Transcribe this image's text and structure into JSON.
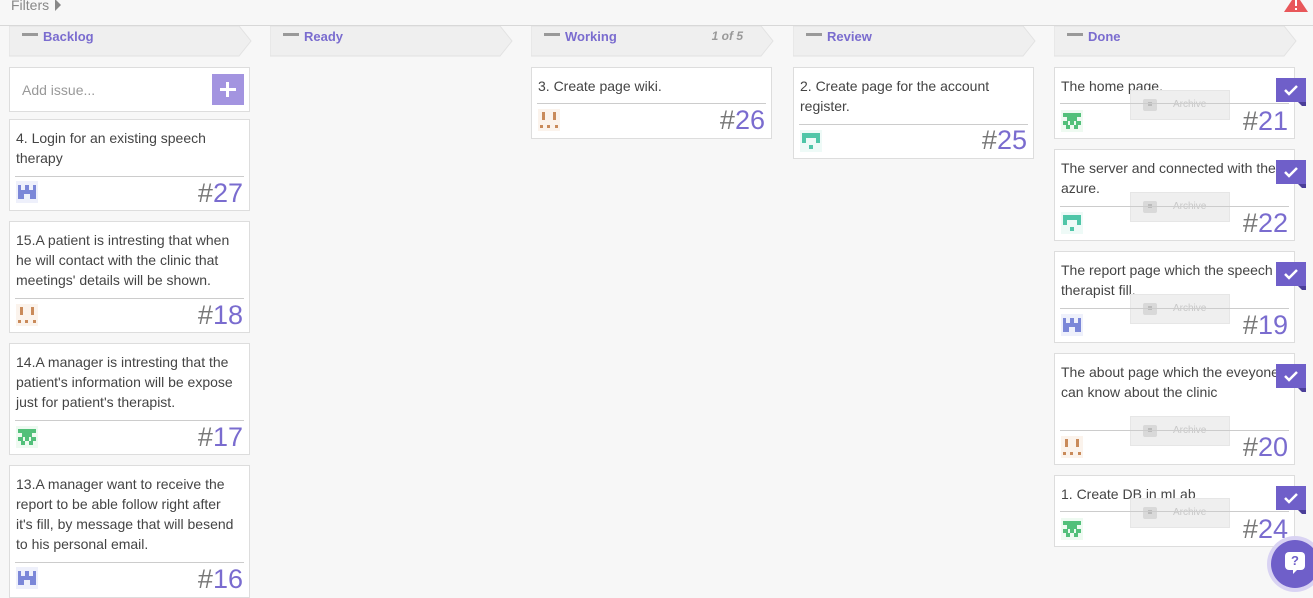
{
  "toolbar": {
    "filters_label": "Filters"
  },
  "columns": [
    {
      "name": "Backlog",
      "count": ""
    },
    {
      "name": "Ready",
      "count": ""
    },
    {
      "name": "Working",
      "count": "1 of 5"
    },
    {
      "name": "Review",
      "count": ""
    },
    {
      "name": "Done",
      "count": ""
    }
  ],
  "backlog": {
    "add_placeholder": "Add issue...",
    "cards": [
      {
        "title": "4. Login for an existing speech therapy",
        "number": "27"
      },
      {
        "title": "15.A patient is intresting that when he will contact with the clinic that meetings' details will be shown.",
        "number": "18"
      },
      {
        "title": "14.A manager is intresting that the patient's information will be expose just for patient's therapist.",
        "number": "17"
      },
      {
        "title": "13.A manager want to receive the report to be able follow right after it's fill, by message that will besend to his personal email.",
        "number": "16"
      }
    ]
  },
  "working": {
    "cards": [
      {
        "title": "3. Create page wiki.",
        "number": "26"
      }
    ]
  },
  "review": {
    "cards": [
      {
        "title": "2. Create page for the account register.",
        "number": "25"
      }
    ]
  },
  "done": {
    "archive_label": "Archive",
    "cards": [
      {
        "title": "The home page.",
        "number": "21"
      },
      {
        "title": "The server and connected with the azure.",
        "number": "22"
      },
      {
        "title": "The report page which the speech therapist fill.",
        "number": "19"
      },
      {
        "title": "The about page which the eveyone can know about the clinic",
        "number": "20"
      },
      {
        "title": "1. Create DB in mLab",
        "number": "24"
      }
    ]
  },
  "hash": "#",
  "help_label": "?",
  "colors": {
    "accent": "#7a6ccf",
    "check": "#6f5fc9",
    "alert": "#e8575a"
  }
}
